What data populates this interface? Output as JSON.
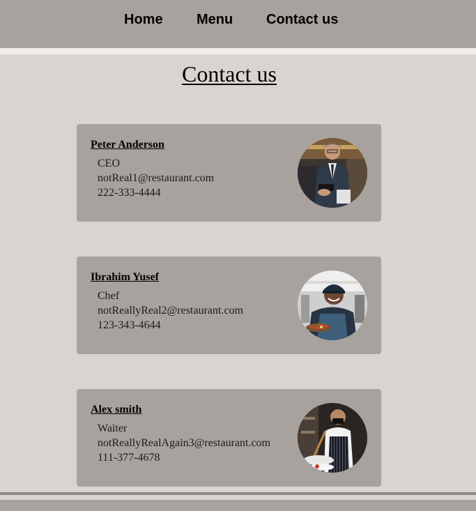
{
  "nav": {
    "items": [
      "Home",
      "Menu",
      "Contact us"
    ]
  },
  "page": {
    "title": "Contact us"
  },
  "contacts": [
    {
      "name": "Peter Anderson",
      "role": "CEO",
      "email": "notReal1@restaurant.com",
      "phone": "222-333-4444",
      "photo_icon": "businessman-photo"
    },
    {
      "name": "Ibrahim Yusef",
      "role": "Chef",
      "email": "notReallyReal2@restaurant.com",
      "phone": "123-343-4644",
      "photo_icon": "chef-photo"
    },
    {
      "name": "Alex smith",
      "role": "Waiter",
      "email": "notReallyRealAgain3@restaurant.com",
      "phone": "111-377-4678",
      "photo_icon": "waiter-photo"
    }
  ],
  "colors": {
    "background": "#d8d4d1",
    "nav_background": "#a7a29e",
    "card_background": "#a7a29e"
  }
}
